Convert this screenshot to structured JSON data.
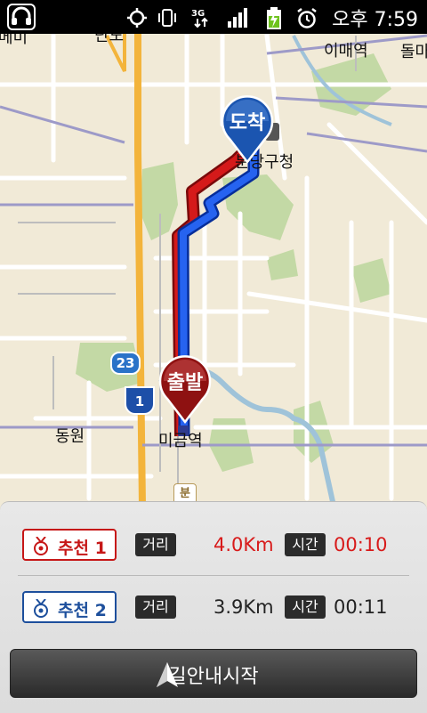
{
  "status_bar": {
    "time": "오후 7:59",
    "icons": [
      "headset-icon",
      "gps-icon",
      "vibrate-icon",
      "3g-icon",
      "signal-icon",
      "battery-icon",
      "alarm-icon"
    ]
  },
  "map": {
    "labels": {
      "top_left": "메미",
      "top_center": "단도",
      "imae": "이매역",
      "dolma": "돌마",
      "gu_office": "분당구청",
      "dongwon": "동원",
      "migeum": "미금역"
    },
    "destination_pin": "도착",
    "origin_pin": "출발",
    "highway_shield_23": "23",
    "highway_shield_1": "1",
    "bun_marker": "분"
  },
  "routes": [
    {
      "label": "추천 1",
      "distance_tag": "거리",
      "distance": "4.0Km",
      "time_tag": "시간",
      "time": "00:10",
      "color": "#d81a1a"
    },
    {
      "label": "추천 2",
      "distance_tag": "거리",
      "distance": "3.9Km",
      "time_tag": "시간",
      "time": "00:11",
      "color": "#1d4f9c"
    }
  ],
  "start_button": {
    "label": "길안내시작"
  }
}
